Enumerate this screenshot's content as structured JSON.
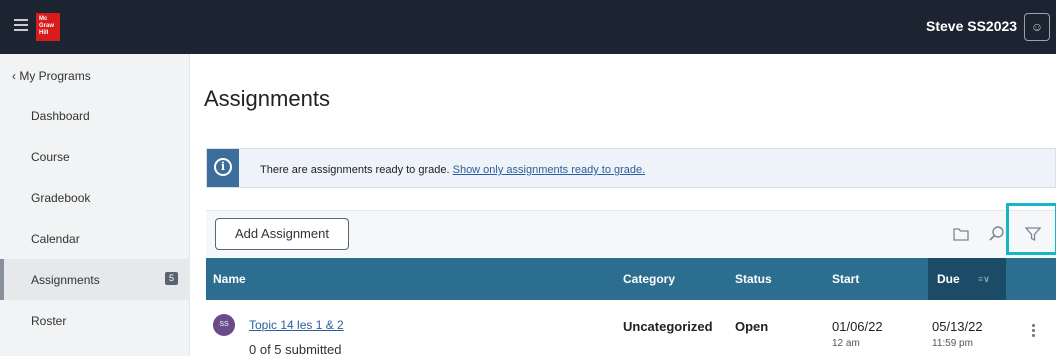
{
  "header": {
    "logo_text": "Mc Graw Hill",
    "username": "Steve SS2023"
  },
  "sidebar": {
    "back_label": "My Programs",
    "items": [
      {
        "label": "Dashboard"
      },
      {
        "label": "Course"
      },
      {
        "label": "Gradebook"
      },
      {
        "label": "Calendar"
      },
      {
        "label": "Assignments",
        "badge": "5",
        "active": true
      },
      {
        "label": "Roster"
      }
    ]
  },
  "main": {
    "title": "Assignments",
    "alert": {
      "icon": "info-icon",
      "text": "There are assignments ready to grade.",
      "link": "Show only assignments ready to grade."
    },
    "toolbar": {
      "add_label": "Add Assignment"
    },
    "table": {
      "columns": [
        "Name",
        "Category",
        "Status",
        "Start",
        "Due"
      ],
      "rows": [
        {
          "avatar": "SS",
          "name": "Topic 14 les 1 & 2",
          "submitted": "0 of 5 submitted",
          "category": "Uncategorized",
          "status": "Open",
          "start_date": "01/06/22",
          "start_time": "12 am",
          "due_date": "05/13/22",
          "due_time": "11:59 pm"
        }
      ]
    }
  },
  "colors": {
    "header_bg": "#1c2431",
    "table_header": "#2b6e8f",
    "sort_column": "#1b4b67",
    "highlight": "#14b8c4",
    "logo_red": "#d91b1b"
  }
}
